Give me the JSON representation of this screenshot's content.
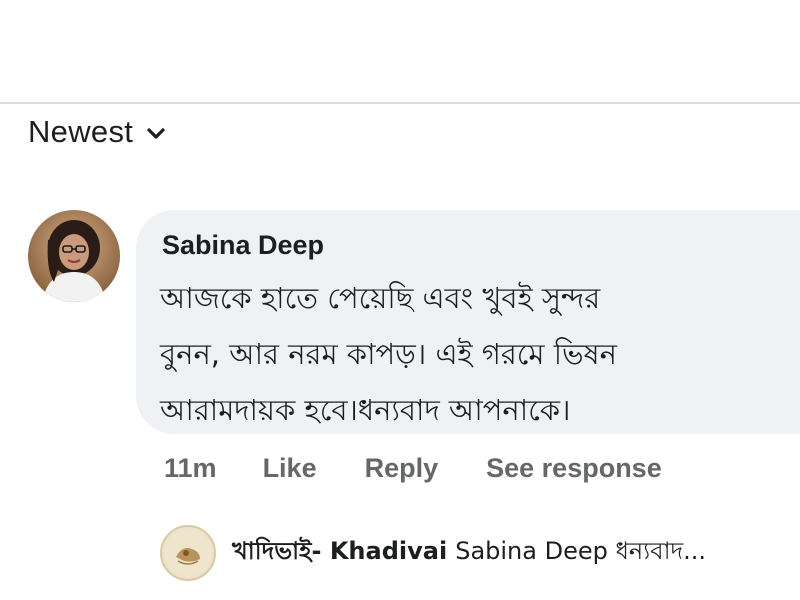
{
  "sort": {
    "label": "Newest",
    "icon": "chevron-down-icon"
  },
  "comment": {
    "author": "Sabina Deep",
    "text_lines": [
      "আজকে হাতে পেয়েছি এবং খুবই সুন্দর",
      "বুনন, আর নরম কাপড়। এই গরমে ভিষন",
      "আরামদায়ক হবে।ধন্যবাদ আপনাকে।"
    ],
    "bubble_color": "#eff1f4",
    "time": "11m",
    "actions": {
      "like": "Like",
      "reply": "Reply",
      "see_response": "See response"
    }
  },
  "reply_preview": {
    "author": "খাদিভাই- Khadivai",
    "snippet": "Sabina Deep ধন্যবাদ..."
  },
  "colors": {
    "text_primary": "#1c1e21",
    "text_secondary": "#65676b",
    "divider": "#dcdde1"
  }
}
